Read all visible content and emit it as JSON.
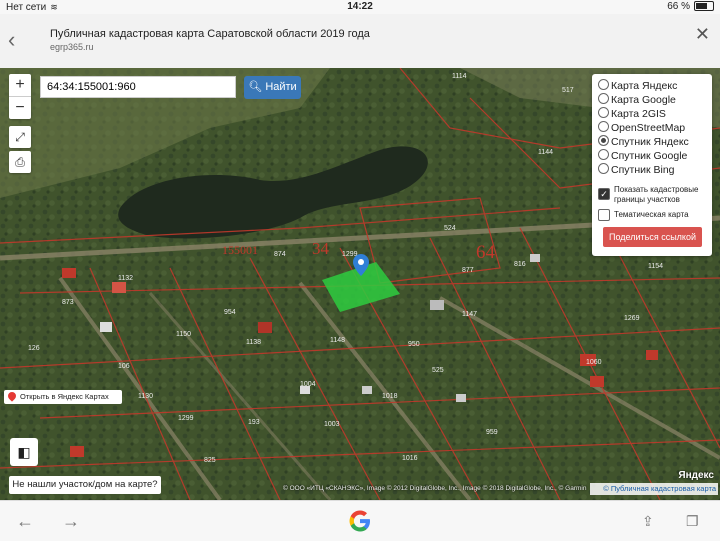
{
  "status": {
    "carrier": "Нет сети",
    "time": "14:22",
    "battery": "66 %",
    "battery_level": 0.66
  },
  "browser": {
    "page_title": "Публичная кадастровая карта Саратовской области 2019 года",
    "domain": "egrp365.ru"
  },
  "search": {
    "value": "64:34:155001:960",
    "button_label": "Найти"
  },
  "layers": {
    "options": [
      "Карта Яндекс",
      "Карта Google",
      "Карта 2GIS",
      "OpenStreetMap",
      "Спутник Яндекс",
      "Спутник Google",
      "Спутник Bing"
    ],
    "selected": "Спутник Яндекс",
    "show_borders_label": "Показать кадастровые границы участков",
    "show_borders": true,
    "thematic_label": "Тематическая карта",
    "thematic": false,
    "share_label": "Поделиться ссылкой"
  },
  "map": {
    "open_yandex": "Открыть в Яндекс Картах",
    "not_found": "Не нашли участок/дом на карте?",
    "copyright": "© ООО «ИТЦ «СКАНЭКС», Image © 2012 DigitalGlobe, Inc., Image © 2018 DigitalGlobe, Inc., © Garmin",
    "cadastral_link": "© Публичная кадастровая карта",
    "yandex_logo": "Яндекс",
    "region_labels": [
      "155001",
      "34",
      "64"
    ],
    "parcel_labels": [
      "1114",
      "517",
      "1144",
      "1299",
      "524",
      "874",
      "877",
      "816",
      "1154",
      "1132",
      "873",
      "1150",
      "954",
      "1138",
      "1148",
      "950",
      "1147",
      "1269",
      "1060",
      "106",
      "126",
      "1130",
      "1004",
      "525",
      "1018",
      "1003",
      "1299",
      "193",
      "959",
      "825",
      "1016"
    ]
  },
  "colors": {
    "accent_blue": "#3a78b8",
    "share_red": "#d9534f",
    "parcel_green": "#2ecc40",
    "border_red": "#c0392b"
  }
}
